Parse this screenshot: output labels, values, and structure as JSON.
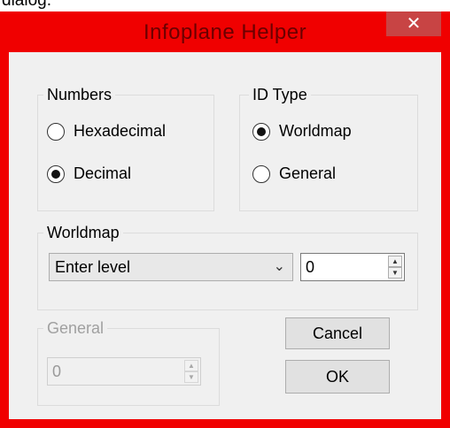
{
  "top_fragment": "dialog.",
  "window": {
    "title": "Infoplane Helper",
    "close_glyph": "✕"
  },
  "numbers_group": {
    "label": "Numbers",
    "options": [
      {
        "label": "Hexadecimal",
        "selected": false
      },
      {
        "label": "Decimal",
        "selected": true
      }
    ]
  },
  "id_type_group": {
    "label": "ID Type",
    "options": [
      {
        "label": "Worldmap",
        "selected": true
      },
      {
        "label": "General",
        "selected": false
      }
    ]
  },
  "worldmap_group": {
    "label": "Worldmap",
    "level_select_value": "Enter level",
    "level_number": "0"
  },
  "general_group": {
    "label": "General",
    "value": "0",
    "disabled": true
  },
  "buttons": {
    "cancel": "Cancel",
    "ok": "OK"
  },
  "colors": {
    "window_frame": "#f00000",
    "client_background": "#f0f0f0",
    "close_button": "#c84444"
  },
  "icons": {
    "close": "close-icon",
    "dropdown": "chevron-down-icon",
    "spin_up": "arrow-up-icon",
    "spin_down": "arrow-down-icon"
  }
}
